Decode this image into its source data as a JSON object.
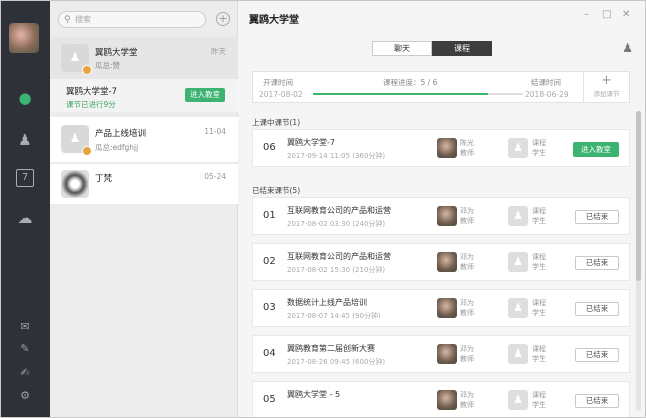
{
  "search": {
    "placeholder": "搜索"
  },
  "sidebar": {
    "icons": [
      "chat-icon",
      "contacts-icon",
      "calendar-icon",
      "cloud-icon"
    ],
    "calendar_day": "7"
  },
  "conversations": [
    {
      "name": "翼鸥大学堂",
      "sub": "瓜总:赞",
      "time": "昨天"
    },
    {
      "name": "产品上线培训",
      "sub": "瓜总:edfghjj",
      "time": "11-04"
    },
    {
      "name": "丁梵",
      "sub": "",
      "time": "05-24"
    }
  ],
  "subclass": {
    "name": "翼鸥大学堂-7",
    "status": "课节已进行9分",
    "button": "进入教室"
  },
  "header": {
    "title": "翼鸥大学堂"
  },
  "tabs": [
    {
      "label": "聊天"
    },
    {
      "label": "课程"
    }
  ],
  "progress": {
    "start_label": "开课时间",
    "start_date": "2017-08-02",
    "progress_label": "课程进度：5 / 6",
    "progress_fraction": 0.8333,
    "end_label": "结课时间",
    "end_date": "2018-06-29",
    "add_label": "添加课节"
  },
  "sections": {
    "ongoing": "上课中课节(1)",
    "finished": "已结束课节(5)"
  },
  "ongoing": [
    {
      "no": "06",
      "name": "翼鸥大学堂-7",
      "time": "2017-09-14 11:05 (360分钟)",
      "teacher": "陈光",
      "teacher_role": "教师",
      "student": "课程",
      "student_role": "学生",
      "action": "进入教室"
    }
  ],
  "finished": [
    {
      "no": "01",
      "name": "互联网教育公司的产品和运营",
      "time": "2017-08-02 03:30 (240分钟)",
      "teacher": "邓为",
      "teacher_role": "教师",
      "student": "课程",
      "student_role": "学生",
      "action": "已结束"
    },
    {
      "no": "02",
      "name": "互联网教育公司的产品和运营",
      "time": "2017-08-02 15:30 (210分钟)",
      "teacher": "邓为",
      "teacher_role": "教师",
      "student": "课程",
      "student_role": "学生",
      "action": "已结束"
    },
    {
      "no": "03",
      "name": "数据统计上线产品培训",
      "time": "2017-08-07 14:45 (90分钟)",
      "teacher": "邓为",
      "teacher_role": "教师",
      "student": "课程",
      "student_role": "学生",
      "action": "已结束"
    },
    {
      "no": "04",
      "name": "翼鸥教育第二届创新大赛",
      "time": "2017-08-26 09:45 (600分钟)",
      "teacher": "邓为",
      "teacher_role": "教师",
      "student": "课程",
      "student_role": "学生",
      "action": "已结束"
    },
    {
      "no": "05",
      "name": "翼鸥大学堂 - 5",
      "time": "",
      "teacher": "邓为",
      "teacher_role": "教师",
      "student": "课程",
      "student_role": "学生",
      "action": "已结束"
    }
  ],
  "colors": {
    "accent": "#3cb371",
    "rail": "#2e3238"
  }
}
